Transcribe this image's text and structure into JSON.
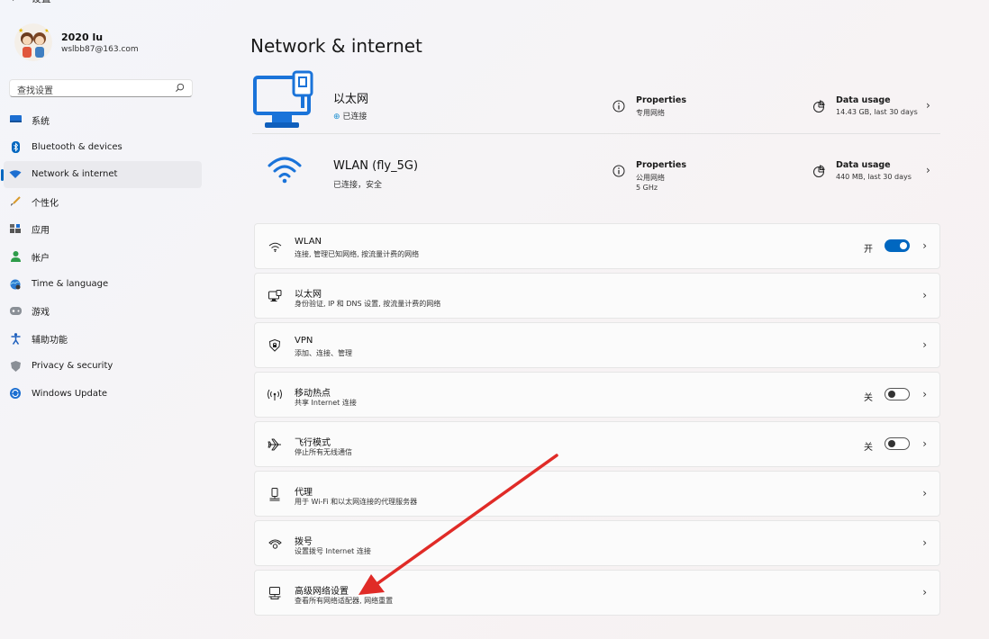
{
  "app": {
    "title": "设置"
  },
  "profile": {
    "name": "2020 lu",
    "email": "wslbb87@163.com"
  },
  "search": {
    "placeholder": "查找设置"
  },
  "sidebar": {
    "items": [
      {
        "label": "系统",
        "icon": "monitor-icon",
        "active": false
      },
      {
        "label": "Bluetooth & devices",
        "icon": "bluetooth-icon",
        "active": false
      },
      {
        "label": "Network & internet",
        "icon": "network-diamond-icon",
        "active": true
      },
      {
        "label": "个性化",
        "icon": "brush-icon",
        "active": false
      },
      {
        "label": "应用",
        "icon": "apps-icon",
        "active": false
      },
      {
        "label": "帐户",
        "icon": "person-icon",
        "active": false
      },
      {
        "label": "Time & language",
        "icon": "globe-clock-icon",
        "active": false
      },
      {
        "label": "游戏",
        "icon": "gamepad-icon",
        "active": false
      },
      {
        "label": "辅助功能",
        "icon": "accessibility-icon",
        "active": false
      },
      {
        "label": "Privacy & security",
        "icon": "shield-icon",
        "active": false
      },
      {
        "label": "Windows Update",
        "icon": "update-icon",
        "active": false
      }
    ]
  },
  "page": {
    "title": "Network & internet"
  },
  "connections": [
    {
      "name": "以太网",
      "status": "已连接",
      "properties_label": "Properties",
      "properties_lines": [
        "专用网络"
      ],
      "usage_label": "Data usage",
      "usage_value": "14.43 GB, last 30 days"
    },
    {
      "name": "WLAN (fly_5G)",
      "status": "已连接，安全",
      "properties_label": "Properties",
      "properties_lines": [
        "公用网络",
        "5 GHz"
      ],
      "usage_label": "Data usage",
      "usage_value": "440 MB, last 30 days"
    }
  ],
  "settings": [
    {
      "title": "WLAN",
      "subtitle": "连接, 管理已知网络, 按流量计费的网络",
      "icon": "wifi-icon",
      "state_label": "开",
      "toggle": "on"
    },
    {
      "title": "以太网",
      "subtitle": "身份验证, IP 和 DNS 设置, 按流量计费的网络",
      "icon": "ethernet-icon"
    },
    {
      "title": "VPN",
      "subtitle": "添加、连接、管理",
      "icon": "vpn-shield-icon"
    },
    {
      "title": "移动热点",
      "subtitle": "共享 Internet 连接",
      "icon": "hotspot-icon",
      "state_label": "关",
      "toggle": "off"
    },
    {
      "title": "飞行模式",
      "subtitle": "停止所有无线通信",
      "icon": "airplane-icon",
      "state_label": "关",
      "toggle": "off"
    },
    {
      "title": "代理",
      "subtitle": "用于 Wi-Fi 和以太网连接的代理服务器",
      "icon": "proxy-icon"
    },
    {
      "title": "拨号",
      "subtitle": "设置拨号 Internet 连接",
      "icon": "dialup-icon"
    },
    {
      "title": "高级网络设置",
      "subtitle": "查看所有网络适配器, 网络重置",
      "icon": "advanced-network-icon"
    }
  ],
  "annotation": {
    "color": "#e02b27",
    "description_target": "高级网络设置"
  }
}
